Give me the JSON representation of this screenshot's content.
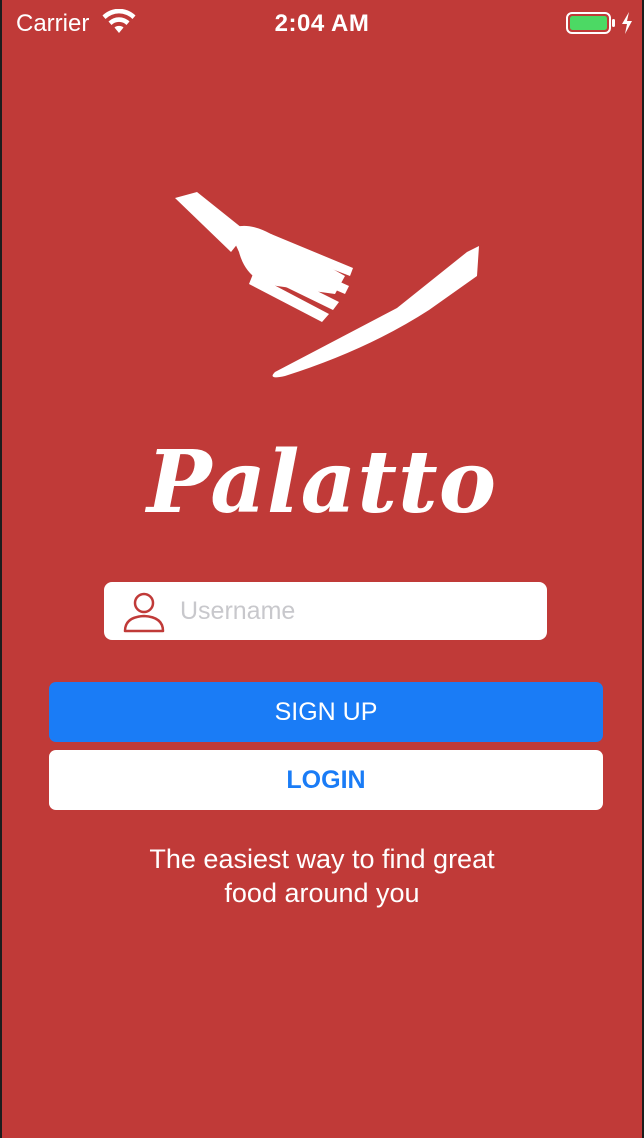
{
  "status_bar": {
    "carrier": "Carrier",
    "time": "2:04 AM",
    "icons": [
      "wifi-icon",
      "battery-icon",
      "charging-icon"
    ]
  },
  "logo": {
    "icon": "fork-knife-icon",
    "title": "Palatto"
  },
  "username": {
    "icon": "user-icon",
    "placeholder": "Username",
    "value": ""
  },
  "buttons": {
    "signup_label": "SIGN UP",
    "login_label": "LOGIN"
  },
  "tagline": {
    "line1": "The easiest way to find great",
    "line2": "food around you"
  },
  "colors": {
    "background": "#c03a38",
    "accent_blue": "#1a7cf6",
    "white": "#ffffff",
    "battery_green": "#4cd964"
  }
}
